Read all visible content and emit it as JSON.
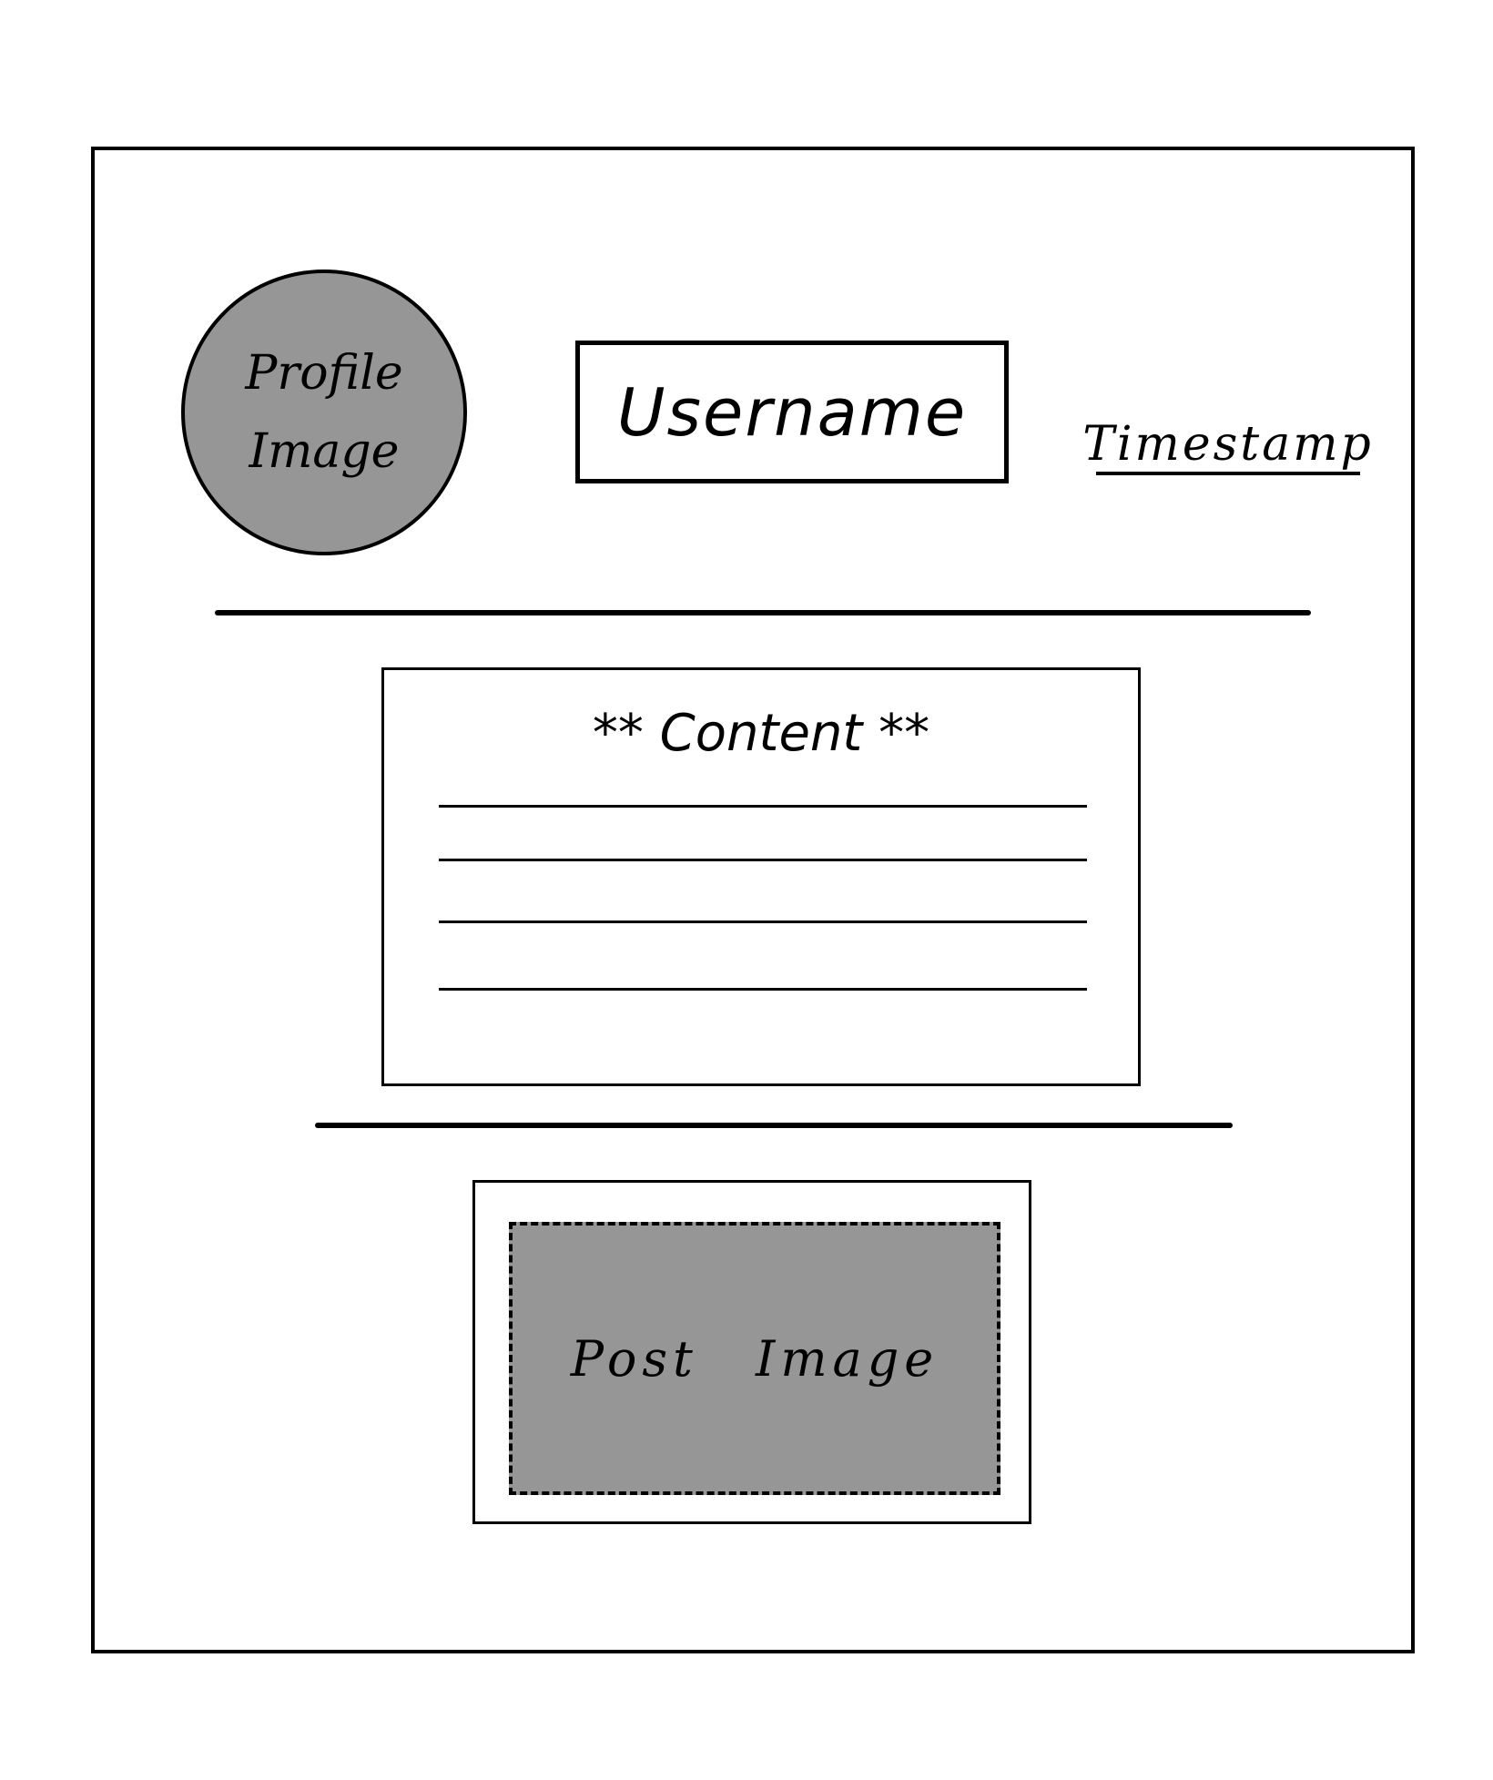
{
  "colors": {
    "placeholder_fill": "#969696",
    "ink": "#000000",
    "background": "#ffffff"
  },
  "post_header": {
    "avatar_label": "Profile\nImage",
    "username": "Username",
    "timestamp": "Timestamp"
  },
  "content": {
    "title": "** Content **",
    "line_count": 4
  },
  "post_image": {
    "label": "Post Image"
  }
}
